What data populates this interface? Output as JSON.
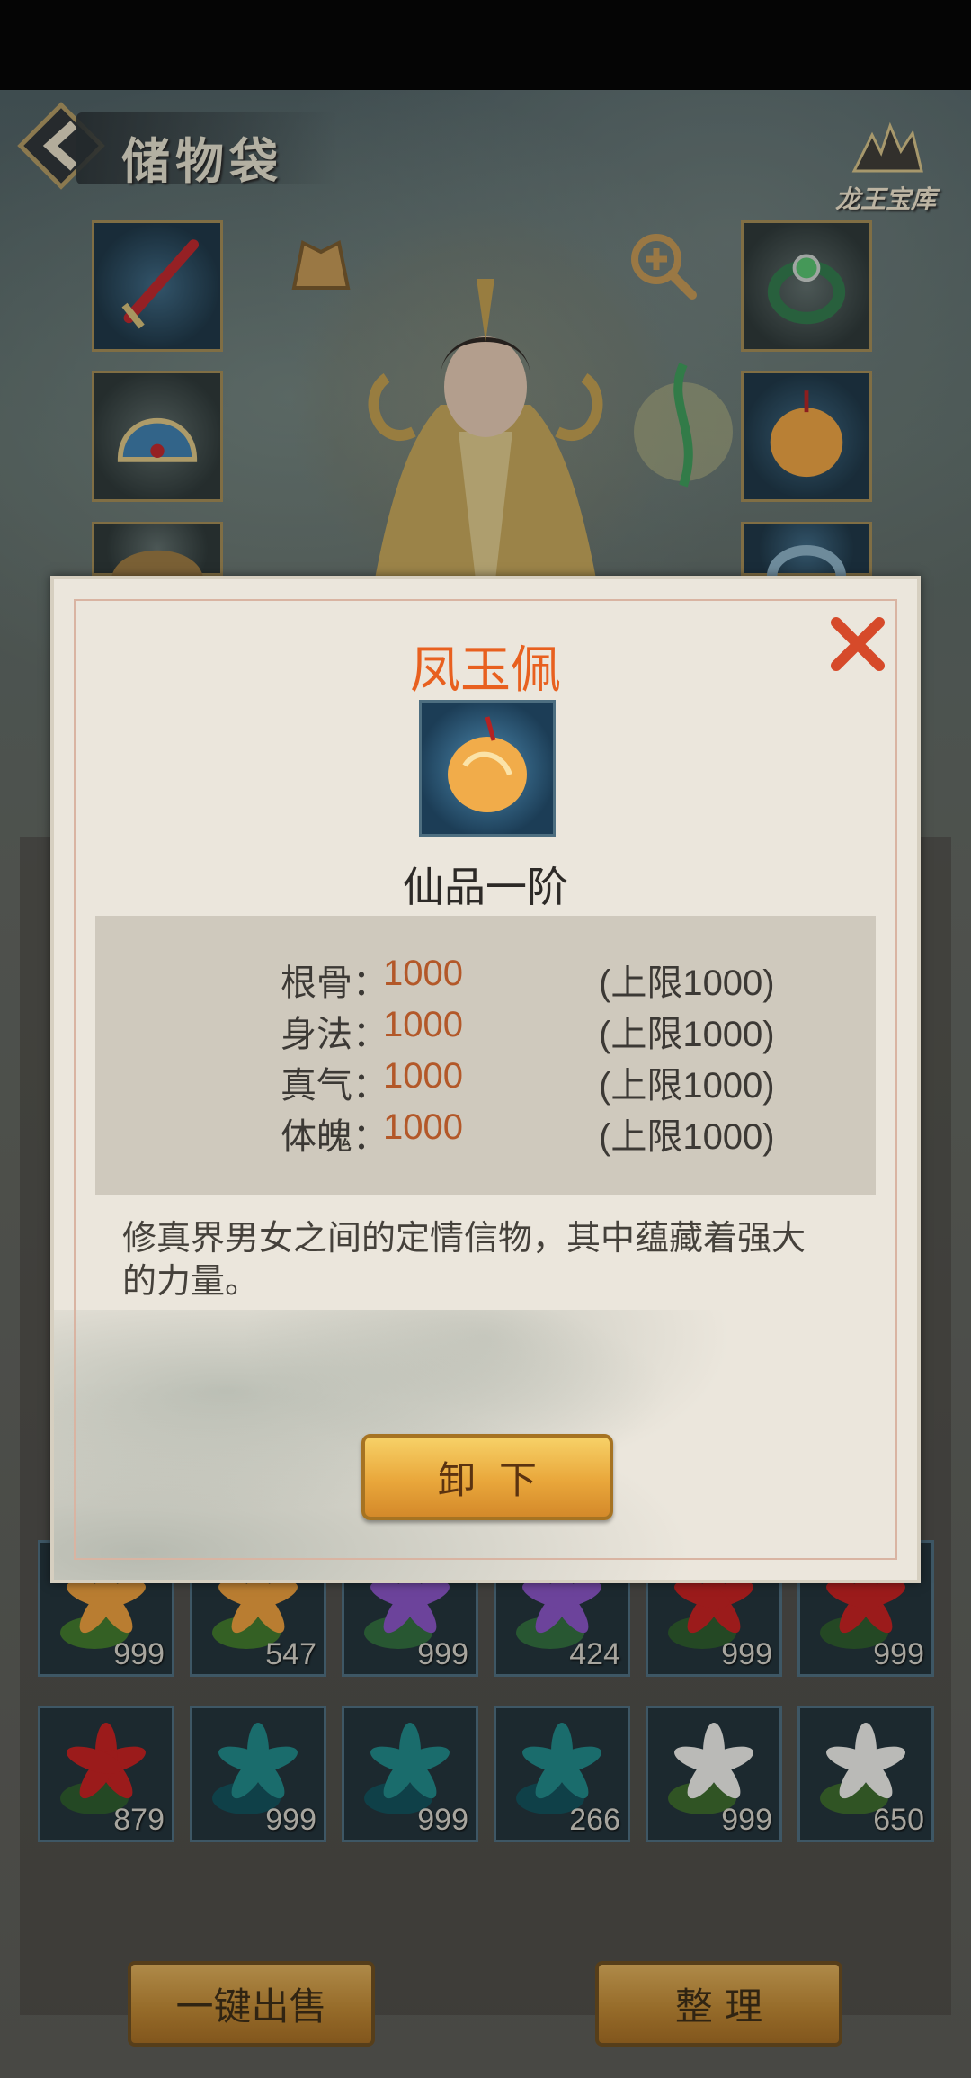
{
  "header": {
    "title": "储物袋",
    "treasury_label": "龙王宝库"
  },
  "equipment": {
    "left_slots": [
      "sword-icon",
      "helmet-icon",
      "armor-icon"
    ],
    "right_slots": [
      "jade-ring-icon",
      "phoenix-pendant-icon",
      "bracelet-icon"
    ]
  },
  "bag": {
    "rows": [
      [
        {
          "icon": "orange-lily-icon",
          "count": "999"
        },
        {
          "icon": "orange-lily-icon",
          "count": "547"
        },
        {
          "icon": "purple-lotus-icon",
          "count": "999"
        },
        {
          "icon": "purple-lotus-icon",
          "count": "424"
        },
        {
          "icon": "red-lotus-icon",
          "count": "999"
        },
        {
          "icon": "red-lotus-icon",
          "count": "999"
        }
      ],
      [
        {
          "icon": "red-lotus-icon",
          "count": "879"
        },
        {
          "icon": "teal-leaf-icon",
          "count": "999"
        },
        {
          "icon": "teal-leaf-icon",
          "count": "999"
        },
        {
          "icon": "teal-leaf-icon",
          "count": "266"
        },
        {
          "icon": "white-orchid-icon",
          "count": "999"
        },
        {
          "icon": "white-orchid-icon",
          "count": "650"
        }
      ]
    ],
    "sell_all_label": "一键出售",
    "sort_label": "整 理"
  },
  "modal": {
    "item_name": "凤玉佩",
    "item_icon": "phoenix-pendant-icon",
    "grade": "仙品一阶",
    "stats": [
      {
        "label": "根骨：",
        "value": "1000",
        "limit": "(上限1000)"
      },
      {
        "label": "身法：",
        "value": "1000",
        "limit": "(上限1000)"
      },
      {
        "label": "真气：",
        "value": "1000",
        "limit": "(上限1000)"
      },
      {
        "label": "体魄：",
        "value": "1000",
        "limit": "(上限1000)"
      }
    ],
    "description": "修真界男女之间的定情信物，其中蕴藏着强大的力量。",
    "unequip_label": "卸下"
  },
  "colors": {
    "item_name": "#e8601f",
    "stat_value": "#b35829",
    "button_gold": "#e9a73b"
  }
}
